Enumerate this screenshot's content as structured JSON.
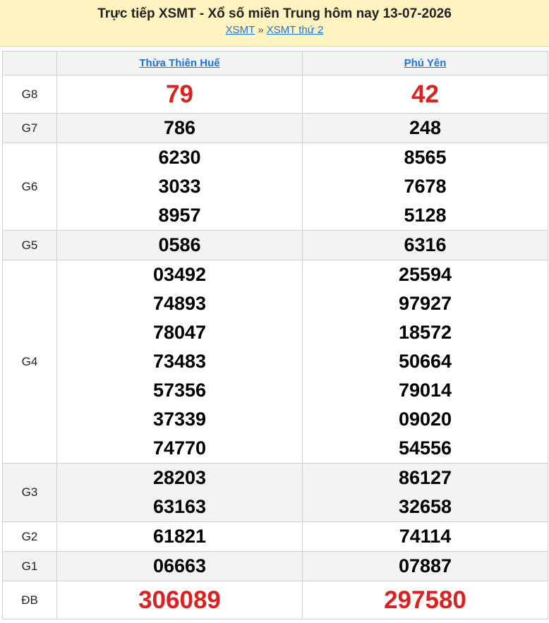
{
  "header": {
    "title": "Trực tiếp XSMT - Xổ số miền Trung hôm nay 13-07-2026",
    "crumb_1": "XSMT",
    "crumb_sep": "»",
    "crumb_2": "XSMT thứ 2"
  },
  "provinces": [
    "Thừa Thiên Huế",
    "Phú Yên"
  ],
  "prizes": [
    {
      "label": "G8",
      "left": [
        "79"
      ],
      "right": [
        "42"
      ],
      "style": "red-big"
    },
    {
      "label": "G7",
      "left": [
        "786"
      ],
      "right": [
        "248"
      ]
    },
    {
      "label": "G6",
      "left": [
        "6230",
        "3033",
        "8957"
      ],
      "right": [
        "8565",
        "7678",
        "5128"
      ]
    },
    {
      "label": "G5",
      "left": [
        "0586"
      ],
      "right": [
        "6316"
      ]
    },
    {
      "label": "G4",
      "left": [
        "03492",
        "74893",
        "78047",
        "73483",
        "57356",
        "37339",
        "74770"
      ],
      "right": [
        "25594",
        "97927",
        "18572",
        "50664",
        "79014",
        "09020",
        "54556"
      ]
    },
    {
      "label": "G3",
      "left": [
        "28203",
        "63163"
      ],
      "right": [
        "86127",
        "32658"
      ]
    },
    {
      "label": "G2",
      "left": [
        "61821"
      ],
      "right": [
        "74114"
      ]
    },
    {
      "label": "G1",
      "left": [
        "06663"
      ],
      "right": [
        "07887"
      ]
    },
    {
      "label": "ĐB",
      "left": [
        "306089"
      ],
      "right": [
        "297580"
      ],
      "style": "red-big"
    }
  ]
}
